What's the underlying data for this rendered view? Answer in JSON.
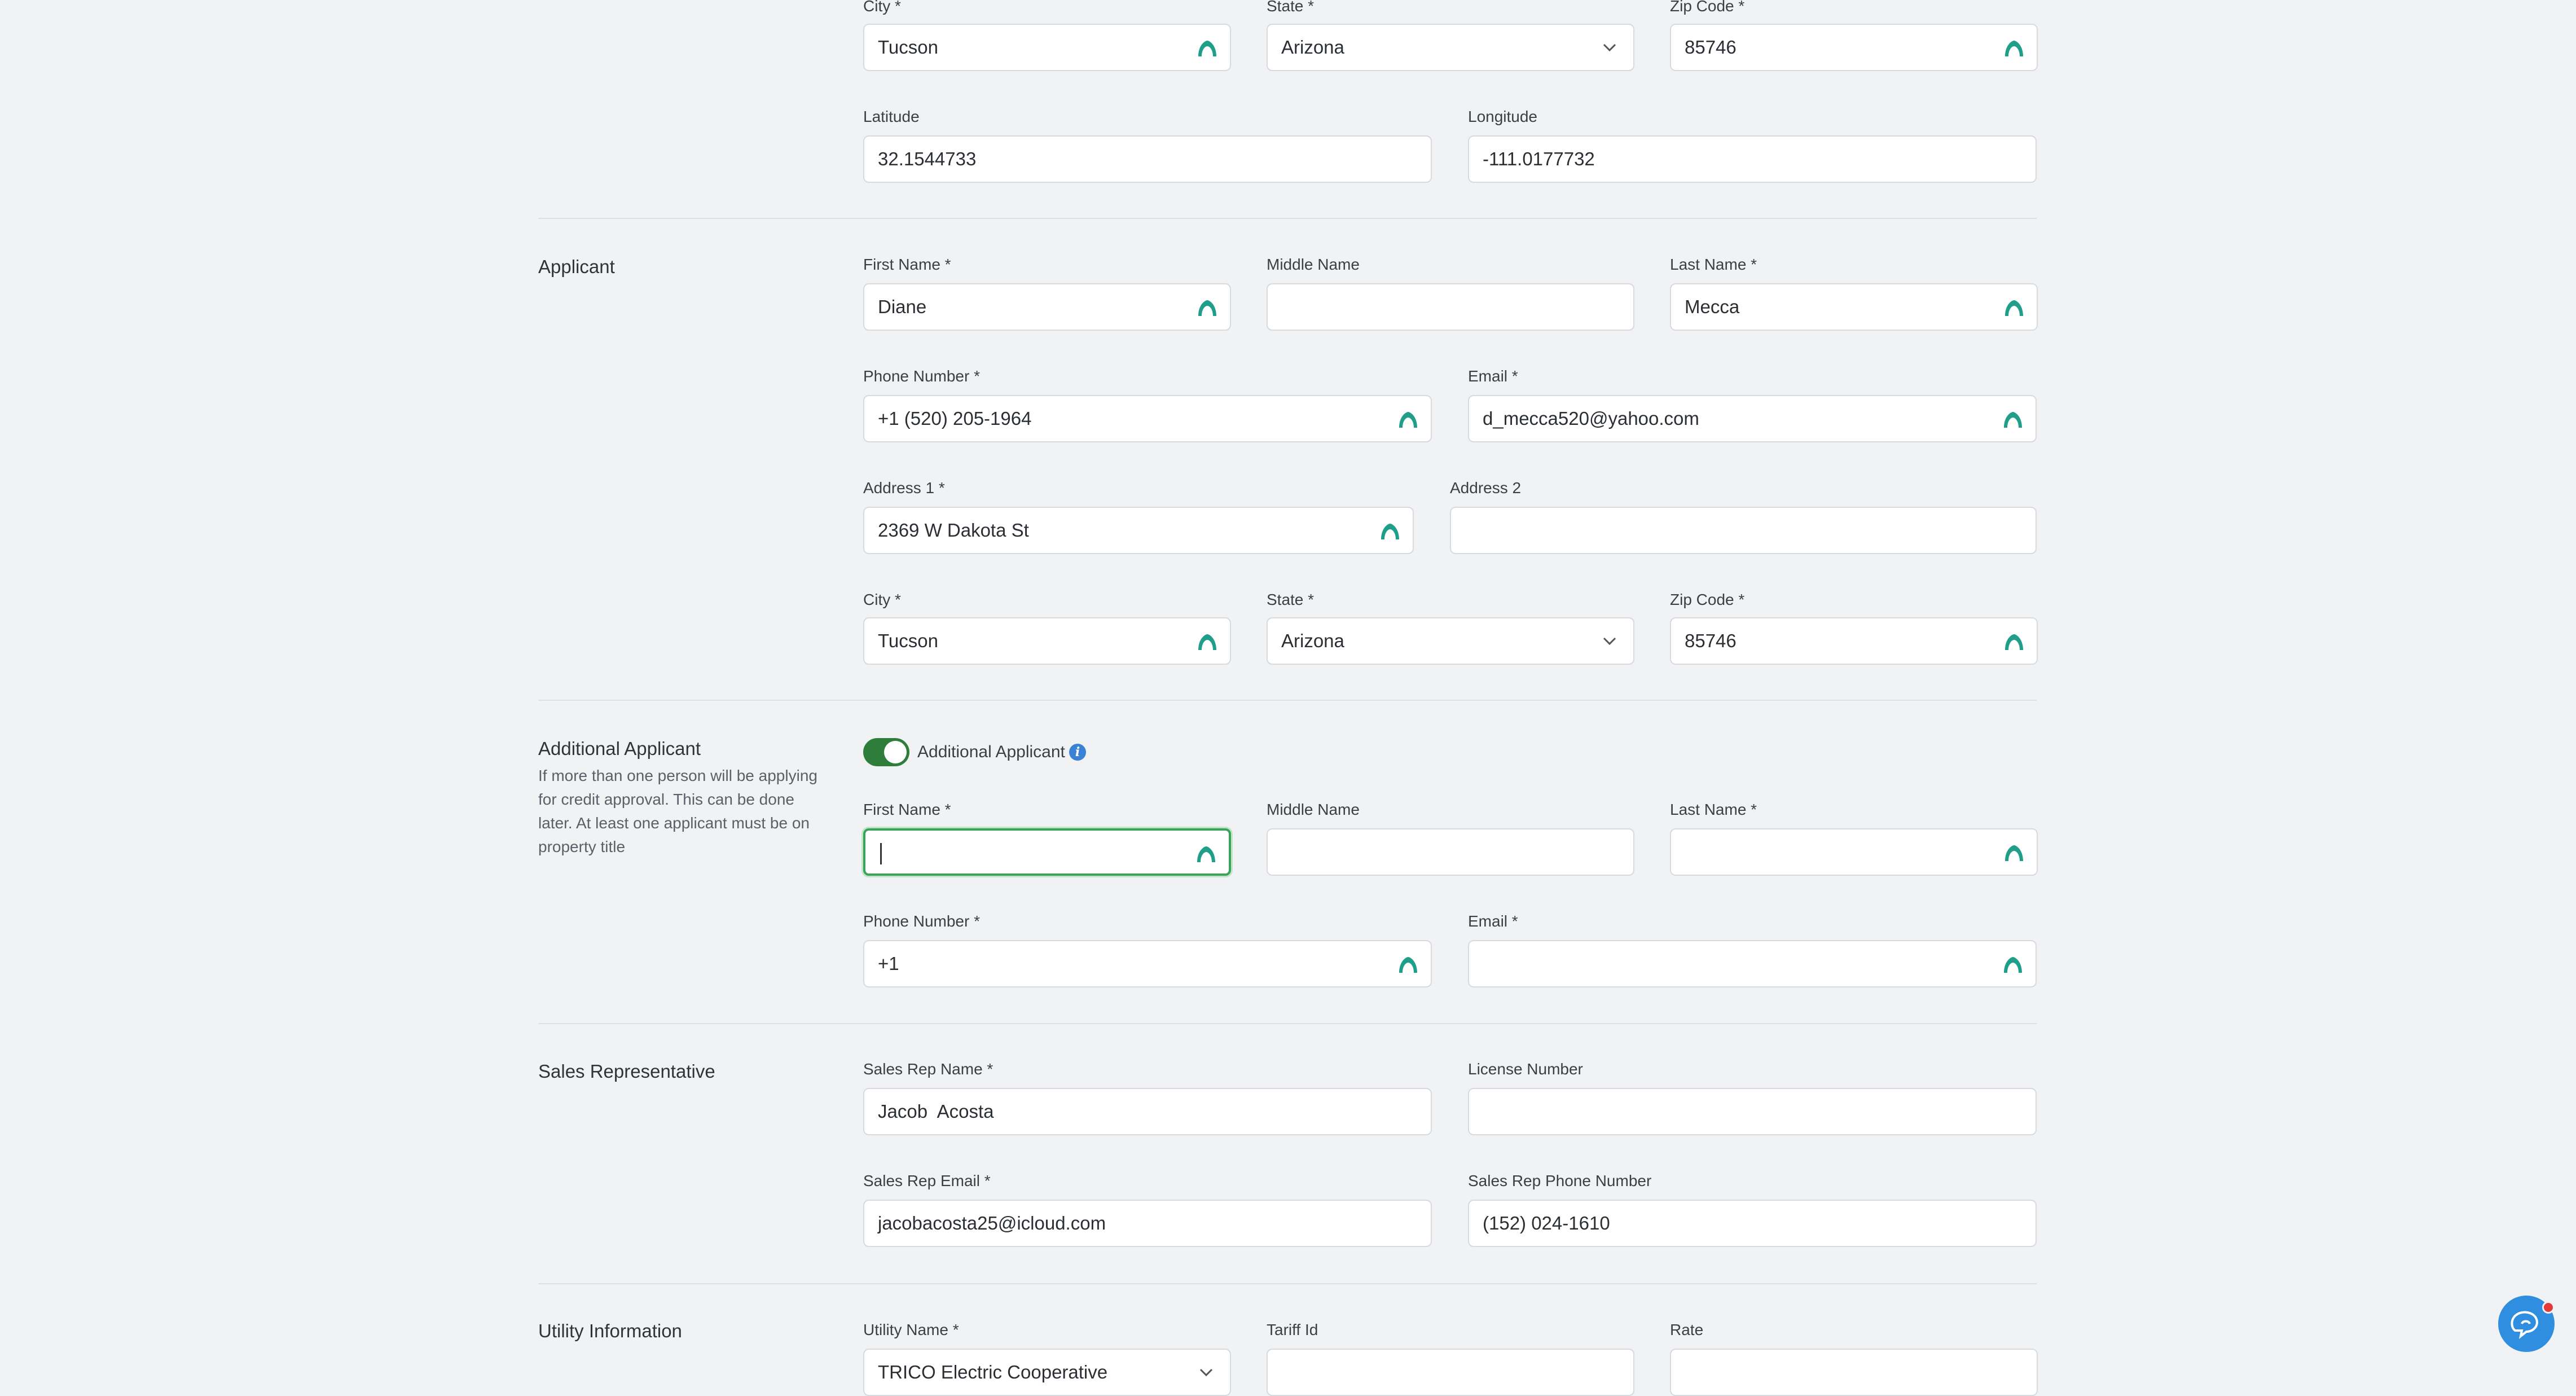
{
  "location": {
    "city_label": "City *",
    "city_value": "Tucson",
    "state_label": "State *",
    "state_value": "Arizona",
    "zip_label": "Zip Code *",
    "zip_value": "85746",
    "lat_label": "Latitude",
    "lat_value": "32.1544733",
    "lon_label": "Longitude",
    "lon_value": "-111.0177732"
  },
  "applicant": {
    "title": "Applicant",
    "first_label": "First Name *",
    "first_value": "Diane",
    "middle_label": "Middle Name",
    "middle_value": "",
    "last_label": "Last Name *",
    "last_value": "Mecca",
    "phone_label": "Phone Number *",
    "phone_value": "+1 (520) 205-1964",
    "email_label": "Email *",
    "email_value": "d_mecca520@yahoo.com",
    "addr1_label": "Address 1 *",
    "addr1_value": "2369 W Dakota St",
    "addr2_label": "Address 2",
    "addr2_value": "",
    "city_label": "City *",
    "city_value": "Tucson",
    "state_label": "State *",
    "state_value": "Arizona",
    "zip_label": "Zip Code *",
    "zip_value": "85746"
  },
  "additional": {
    "title": "Additional Applicant",
    "description": "If more than one person will be applying for credit approval. This can be done later. At least one applicant must be on property title",
    "toggle_label": "Additional Applicant",
    "toggle_on": true,
    "first_label": "First Name *",
    "first_value": "",
    "middle_label": "Middle Name",
    "middle_value": "",
    "last_label": "Last Name *",
    "last_value": "",
    "phone_label": "Phone Number *",
    "phone_value": "+1",
    "email_label": "Email *",
    "email_value": ""
  },
  "sales": {
    "title": "Sales Representative",
    "name_label": "Sales Rep Name *",
    "name_value": "Jacob  Acosta",
    "license_label": "License Number",
    "license_value": "",
    "email_label": "Sales Rep Email *",
    "email_value": "jacobacosta25@icloud.com",
    "phone_label": "Sales Rep Phone Number",
    "phone_value": "(152) 024-1610"
  },
  "utility": {
    "title": "Utility Information",
    "name_label": "Utility Name *",
    "name_value": "TRICO Electric Cooperative",
    "tariff_label": "Tariff Id",
    "tariff_value": "",
    "rate_label": "Rate",
    "rate_value": ""
  },
  "colors": {
    "autofill_icon": "#1f9e8a",
    "focus_border": "#3aa35a",
    "toggle_on": "#2f7d3b",
    "info_icon": "#3b82d6",
    "chat_button": "#2f8ee0"
  }
}
